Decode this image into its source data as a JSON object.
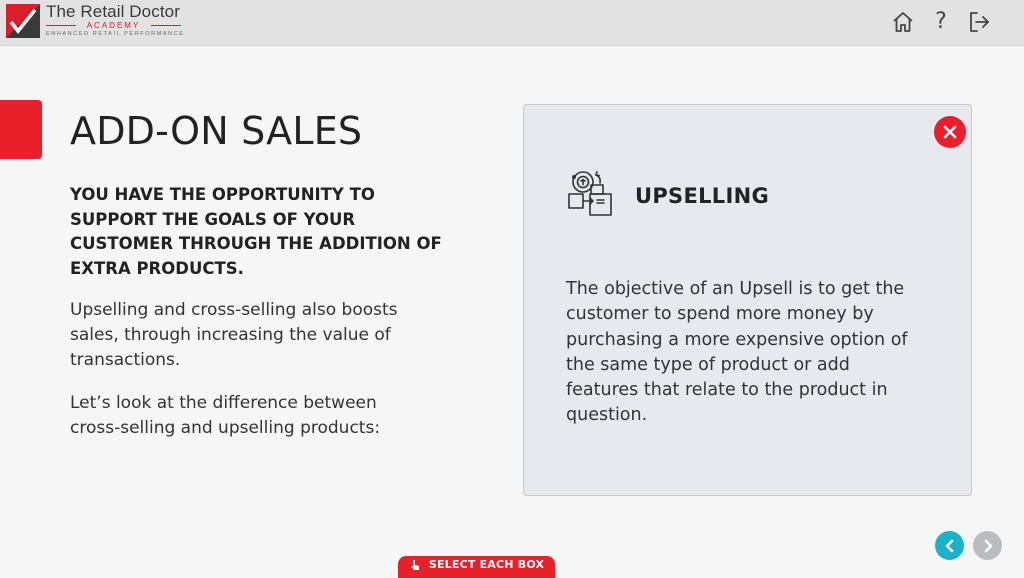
{
  "header": {
    "brand_name": "The Retail Doctor",
    "brand_academy": "ACADEMY",
    "brand_tagline": "ENHANCED RETAIL PERFORMANCE",
    "icons": [
      "home-icon",
      "help-icon",
      "exit-icon"
    ],
    "help_glyph": "?"
  },
  "main": {
    "title": "ADD-ON SALES",
    "lead": "YOU HAVE THE OPPORTUNITY TO SUPPORT THE GOALS OF YOUR CUSTOMER THROUGH THE ADDITION OF EXTRA PRODUCTS.",
    "para1": "Upselling and cross-selling also boosts sales, through increasing the value of transactions.",
    "para2": "Let’s look at the difference between cross-selling and upselling products:"
  },
  "card": {
    "icon": "upsell-icon",
    "title": "UPSELLING",
    "body": "The objective of an Upsell is to get the customer to spend more money by purchasing a more expensive option of the same type of product or add features that relate to the product in question."
  },
  "footer": {
    "instruction": "SELECT EACH BOX"
  },
  "colors": {
    "accent_red": "#e8202a",
    "nav_active": "#1ab2c9",
    "nav_inactive": "#b9bcc0",
    "card_bg": "#e6e9ee"
  }
}
